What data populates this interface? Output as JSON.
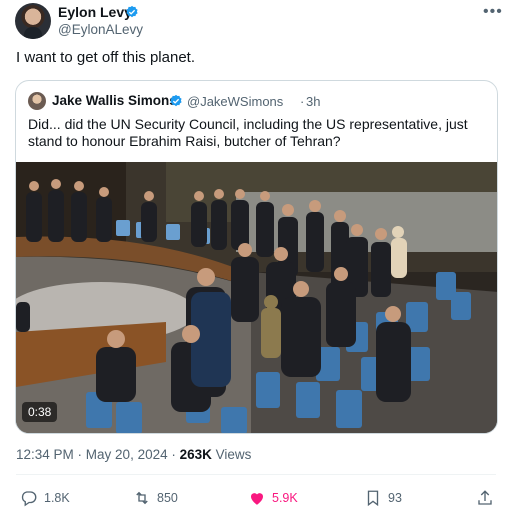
{
  "author": {
    "name": "Eylon Levy",
    "handle": "@EylonALevy"
  },
  "tweet_text": "I want to get off this planet.",
  "quoted": {
    "name": "Jake Wallis Simons",
    "handle": "@JakeWSimons",
    "dot": "·",
    "time": "3h",
    "text": "Did... did the UN Security Council, including the US representative, just stand to honour Ebrahim Raisi, butcher of Tehran?",
    "video_duration": "0:38"
  },
  "meta": {
    "time": "12:34 PM",
    "sep1": " · ",
    "date": "May 20, 2024",
    "sep2": " · ",
    "views_count": "263K",
    "views_label": " Views"
  },
  "actions": {
    "replies": "1.8K",
    "reposts": "850",
    "likes": "5.9K",
    "bookmarks": "93"
  },
  "colors": {
    "verified": "#1d9bf0",
    "like": "#f91880",
    "secondary_text": "#536471"
  }
}
